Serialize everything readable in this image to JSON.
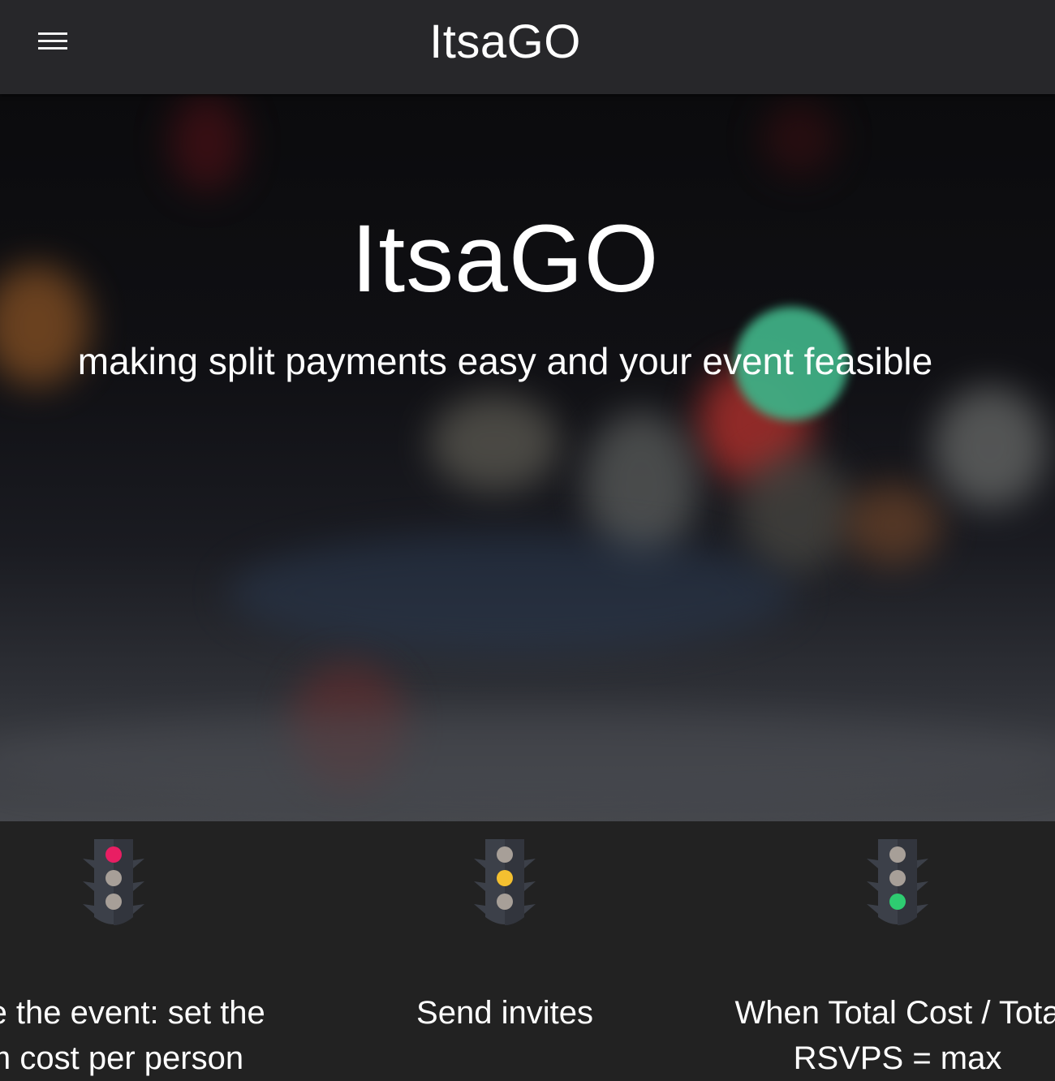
{
  "header": {
    "menu_icon": "hamburger-menu-icon",
    "brand": "ItsaGO"
  },
  "hero": {
    "title": "ItsaGO",
    "tagline": "making split payments easy and your event feasible"
  },
  "steps": [
    {
      "icon": "traffic-light-red-icon",
      "active_color": "#e91e63",
      "text_line1": "ate the event: set the",
      "text_line2": "m cost per person"
    },
    {
      "icon": "traffic-light-yellow-icon",
      "active_color": "#f4c030",
      "text_line1": "Send invites",
      "text_line2": ""
    },
    {
      "icon": "traffic-light-green-icon",
      "active_color": "#2ecc71",
      "text_line1": "When Total Cost / Tota",
      "text_line2": "RSVPS = max"
    }
  ],
  "colors": {
    "header_bg": "#27272a",
    "page_bg": "#222222",
    "light_off": "#a79f98",
    "light_housing": "#3c4049"
  }
}
